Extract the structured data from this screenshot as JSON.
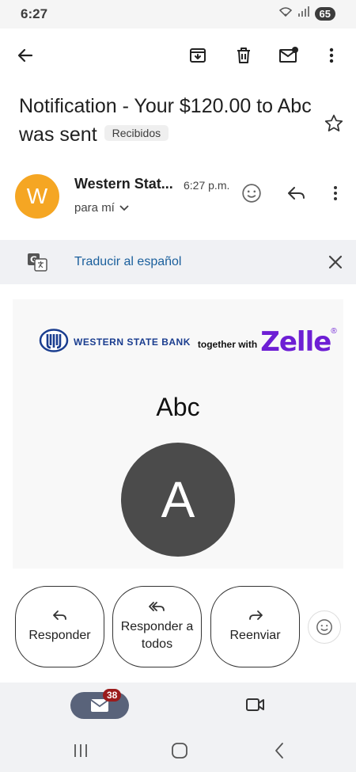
{
  "status_bar": {
    "time": "6:27",
    "battery": "65"
  },
  "email": {
    "subject": "Notification - Your  $120.00 to Abc was sent",
    "label": "Recibidos",
    "sender": {
      "initial": "W",
      "name": "Western Stat...",
      "time": "6:27 p.m.",
      "recipient": "para mí"
    }
  },
  "translate": {
    "link": "Traducir al español"
  },
  "body": {
    "bank_name": "WESTERN STATE BANK",
    "together_with": "together with",
    "zelle": "Zelle",
    "zelle_registered": "®",
    "recipient_name": "Abc",
    "recipient_initial": "A"
  },
  "actions": {
    "reply": "Responder",
    "reply_all": "Responder a todos",
    "forward": "Reenviar"
  },
  "bottom_nav": {
    "mail_badge": "38"
  },
  "icons": [
    "back-icon",
    "archive-icon",
    "delete-icon",
    "mark-unread-icon",
    "more-vert-icon",
    "star-icon",
    "emoji-icon",
    "reply-icon",
    "translate-icon",
    "close-icon",
    "chevron-down-icon",
    "reply-all-icon",
    "forward-icon",
    "mail-icon",
    "video-icon",
    "recents-icon",
    "home-icon",
    "back-nav-icon",
    "wifi-icon",
    "signal-icon"
  ],
  "colors": {
    "sender_avatar": "#f5a623",
    "recipient_avatar": "#4b4b4b",
    "zelle": "#6d1ed4",
    "link": "#1a5f9c",
    "badge": "#9b1c1c",
    "mail_pill": "#59637a"
  }
}
